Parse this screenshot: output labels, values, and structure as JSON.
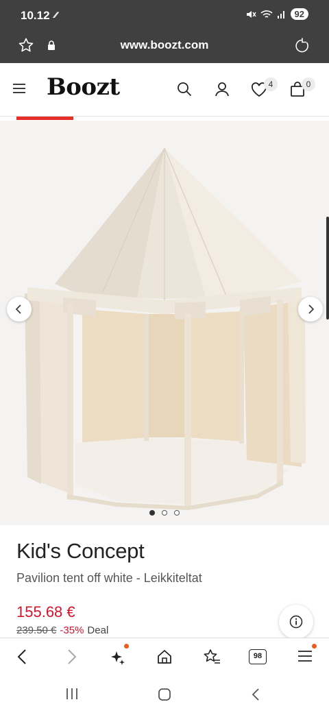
{
  "status_bar": {
    "time": "10.12",
    "battery": "92"
  },
  "browser": {
    "url": "www.boozt.com"
  },
  "header": {
    "logo": "Boozt",
    "wishlist_count": "4",
    "cart_count": "0"
  },
  "product": {
    "brand": "Kid's Concept",
    "title": "Pavilion tent off white - Leikkiteltat",
    "price": "155.68 €",
    "old_price": "239.50 €",
    "discount": "-35%",
    "deal_label": "Deal",
    "image_count": 3,
    "active_image": 1
  },
  "toolbar": {
    "tab_count": "98"
  },
  "colors": {
    "accent_red": "#e63027",
    "price_red": "#d6122b",
    "status_bg": "#404040"
  }
}
